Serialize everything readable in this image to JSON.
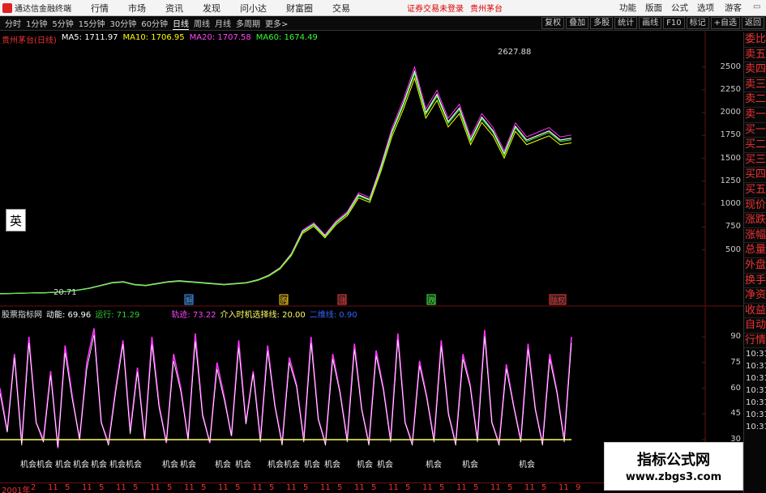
{
  "app": {
    "title": "通达信金融终端"
  },
  "menu": [
    "行情",
    "市场",
    "资讯",
    "发现",
    "问小达",
    "财富圈",
    "交易"
  ],
  "alert": {
    "text": "证券交易未登录",
    "stock": "贵州茅台"
  },
  "menu_right": [
    "功能",
    "版面",
    "公式",
    "选项"
  ],
  "guest": "游客",
  "periods": [
    "分时",
    "1分钟",
    "5分钟",
    "15分钟",
    "30分钟",
    "60分钟",
    "日线",
    "周线",
    "月线",
    "多周期",
    "更多>"
  ],
  "active_period": "日线",
  "tools": [
    "复权",
    "叠加",
    "多股",
    "统计",
    "画线",
    "F10",
    "标记",
    "+自选",
    "返回"
  ],
  "main_legend": {
    "title": "贵州茅台(日线)",
    "ma5": "MA5: 1711.97",
    "ma10": "MA10: 1706.95",
    "ma20": "MA20: 1707.58",
    "ma60": "MA60: 1674.49"
  },
  "colors": {
    "ma5": "#ffffff",
    "ma10": "#ffff00",
    "ma20": "#ff00ff",
    "ma60": "#00ff00",
    "up": "#ff3333",
    "down": "#00ffff",
    "indicator": "#ff33ff"
  },
  "right_panel": [
    "委比",
    "卖五",
    "卖四",
    "卖三",
    "卖二",
    "卖一",
    "买一",
    "买二",
    "买三",
    "买四",
    "买五",
    "现价",
    "涨跌",
    "涨幅",
    "总量",
    "外盘",
    "换手",
    "净资",
    "收益",
    "自动",
    "行情"
  ],
  "right_times": [
    "10:31",
    "10:31",
    "10:31",
    "10:31",
    "10:31",
    "10:31",
    "10:31"
  ],
  "ime": "英",
  "lower_legend": {
    "name": "股票指标网",
    "motion": "动能: 69.96",
    "run": "运行: 71.29",
    "track": "轨迹: 73.22",
    "entry": "介入时机选择线: 20.00",
    "extra": "二维线: 0.90"
  },
  "events": [
    "解",
    "购",
    "涨",
    "跌",
    "除权"
  ],
  "signals": [
    "机会",
    "机会",
    "机会",
    "机会",
    "机会",
    "机会",
    "机会",
    "机会",
    "机会",
    "机会",
    "机会",
    "机会",
    "机会",
    "机会",
    "机会",
    "机会",
    "机会",
    "机会",
    "机会",
    "机会"
  ],
  "dates": [
    "2001年",
    "2",
    "11",
    "5",
    "11",
    "5",
    "11",
    "5",
    "11",
    "5",
    "11",
    "5",
    "11",
    "5",
    "11",
    "5",
    "11",
    "5",
    "11",
    "5",
    "11",
    "5",
    "11",
    "5",
    "11",
    "5",
    "11",
    "5",
    "11",
    "5",
    "11",
    "5",
    "11",
    "9"
  ],
  "watermark": {
    "title": "指标公式网",
    "url": "www.zbgs3.com"
  },
  "chart_data": [
    {
      "type": "line",
      "title": "贵州茅台(日线)",
      "yticks": [
        2500,
        2250,
        2000,
        1750,
        1500,
        1250,
        1000,
        750,
        500
      ],
      "ylim": [
        0,
        2700
      ],
      "high_label": "2627.88",
      "low_label": "20.71",
      "series": [
        {
          "name": "MA5",
          "values": [
            20,
            22,
            25,
            28,
            30,
            35,
            45,
            60,
            80,
            110,
            140,
            150,
            120,
            110,
            130,
            150,
            160,
            150,
            140,
            130,
            120,
            130,
            140,
            170,
            220,
            300,
            450,
            700,
            780,
            650,
            800,
            900,
            1100,
            1050,
            1400,
            1800,
            2100,
            2450,
            2000,
            2200,
            1900,
            2050,
            1700,
            1950,
            1800,
            1550,
            1850,
            1700,
            1750,
            1800,
            1700,
            1720
          ]
        }
      ]
    },
    {
      "type": "line",
      "title": "",
      "yticks": [
        90,
        75,
        60,
        45,
        30
      ],
      "ylim": [
        22,
        100
      ],
      "threshold": 30,
      "series": [
        {
          "name": "轨迹",
          "values": [
            60,
            35,
            80,
            28,
            90,
            40,
            30,
            70,
            25,
            85,
            55,
            30,
            75,
            95,
            40,
            28,
            60,
            88,
            35,
            72,
            30,
            90,
            50,
            28,
            80,
            60,
            30,
            92,
            45,
            28,
            75,
            55,
            32,
            88,
            40,
            70,
            30,
            85,
            50,
            28,
            78,
            62,
            30,
            90,
            42,
            28,
            80,
            58,
            30,
            86,
            48,
            28,
            82,
            60,
            30,
            92,
            40,
            28,
            76,
            55,
            30,
            88,
            45,
            28,
            80,
            62,
            30,
            94,
            40,
            28,
            74,
            50,
            30,
            86,
            48,
            28,
            80,
            58,
            30,
            90
          ]
        }
      ]
    }
  ]
}
